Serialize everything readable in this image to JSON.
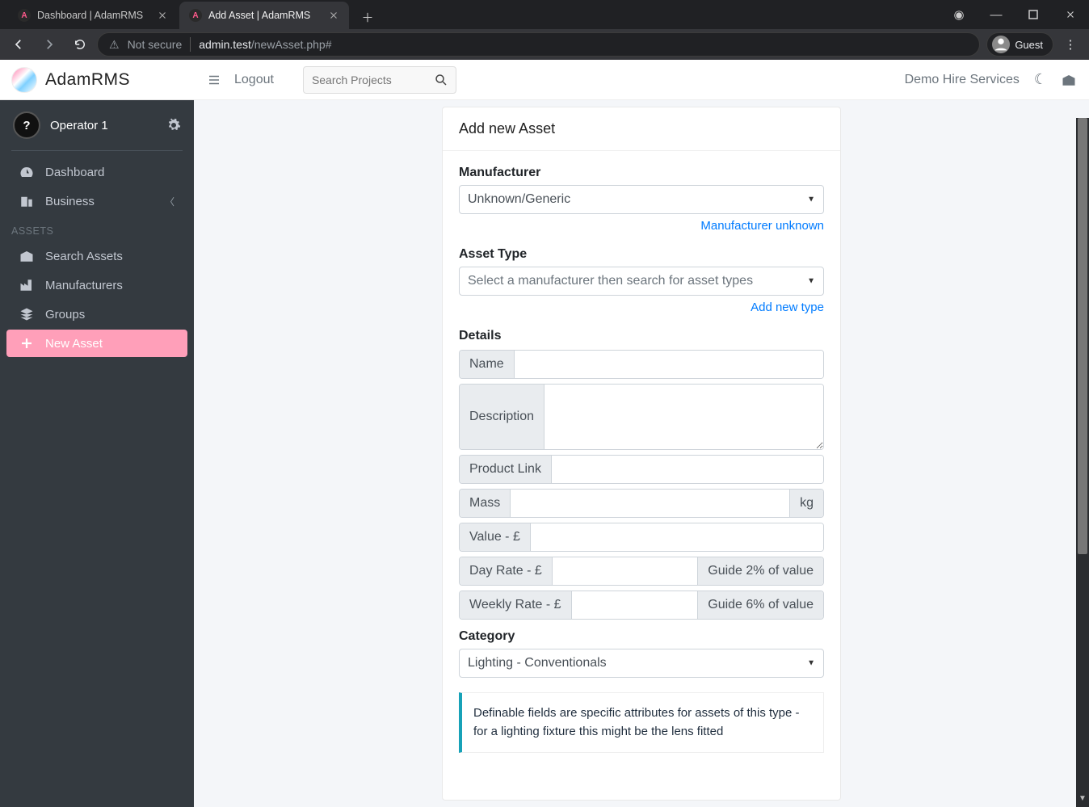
{
  "browser": {
    "tabs": [
      {
        "title": "Dashboard | AdamRMS",
        "fav": "A",
        "active": false
      },
      {
        "title": "Add Asset | AdamRMS",
        "fav": "A",
        "active": true
      }
    ],
    "not_secure": "Not secure",
    "url_host": "admin.test",
    "url_path": "/newAsset.php#",
    "guest": "Guest"
  },
  "sidebar": {
    "brand": "AdamRMS",
    "user": "Operator 1",
    "nav": [
      {
        "label": "Dashboard"
      },
      {
        "label": "Business",
        "expandable": true
      }
    ],
    "section": "ASSETS",
    "asset_nav": [
      {
        "label": "Search Assets"
      },
      {
        "label": "Manufacturers"
      },
      {
        "label": "Groups"
      },
      {
        "label": "New Asset",
        "active": true
      }
    ]
  },
  "topbar": {
    "logout": "Logout",
    "search_placeholder": "Search Projects",
    "tenant": "Demo Hire Services"
  },
  "form": {
    "title": "Add new Asset",
    "fields": {
      "manufacturer": {
        "label": "Manufacturer",
        "value": "Unknown/Generic",
        "help": "Manufacturer unknown"
      },
      "asset_type": {
        "label": "Asset Type",
        "placeholder": "Select a manufacturer then search for asset types",
        "help": "Add new type"
      },
      "details": "Details",
      "name": "Name",
      "description": "Description",
      "productlink": "Product Link",
      "mass": {
        "label": "Mass",
        "unit": "kg"
      },
      "value": "Value - £",
      "dayrate": {
        "label": "Day Rate - £",
        "hint": "Guide 2% of value"
      },
      "weekrate": {
        "label": "Weekly Rate - £",
        "hint": "Guide 6% of value"
      },
      "category": {
        "label": "Category",
        "value": "Lighting - Conventionals"
      },
      "definable_info": "Definable fields are specific attributes for assets of this type - for a lighting fixture this might be the lens fitted"
    }
  }
}
